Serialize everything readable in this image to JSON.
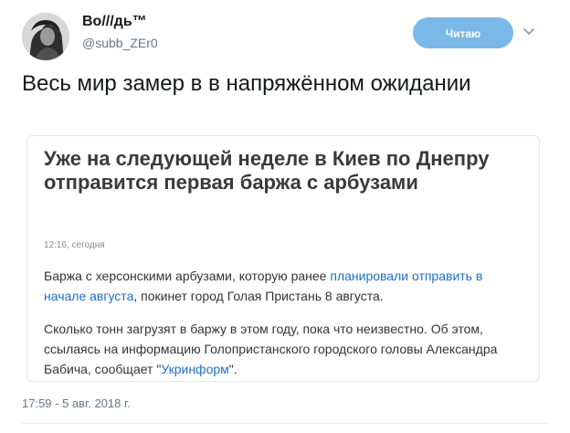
{
  "author": {
    "name": "Во///дь™",
    "handle": "@subb_ZEr0"
  },
  "follow_button": {
    "label": "Читаю"
  },
  "tweet": {
    "text": "Весь мир замер в в напряжённом ожидании",
    "date": "17:59 - 5 авг. 2018 г."
  },
  "card": {
    "title": "Уже на следующей неделе в Киев по Днепру отправится первая баржа с арбузами",
    "time": "12:16, сегодня",
    "p1": {
      "before": "Баржа с херсонскими арбузами, которую ранее ",
      "link": "планировали отправить в начале августа",
      "after": ", покинет город Голая Пристань 8 августа."
    },
    "p2": {
      "before": "Сколько тонн загрузят в баржу в этом году, пока что неизвестно. Об этом, ссылаясь на информацию Голопристанского городского головы Александра Бабича, сообщает \"",
      "link": "Укринформ",
      "after": "\"."
    }
  },
  "icons": {
    "avatar": "portrait-avatar",
    "caret": "chevron-down-icon"
  }
}
